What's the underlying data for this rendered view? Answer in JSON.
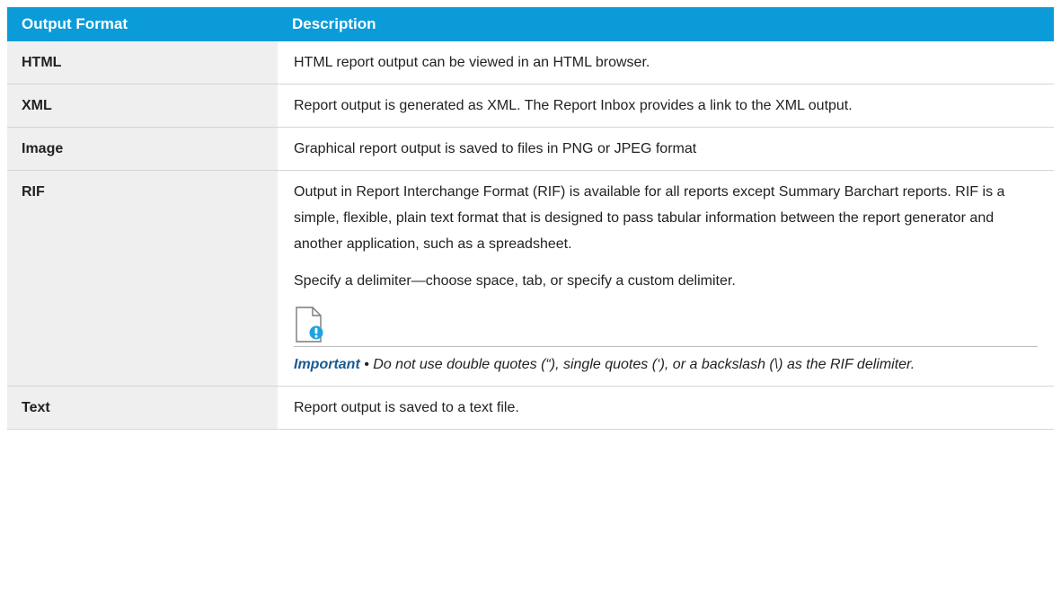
{
  "table": {
    "headers": {
      "format": "Output Format",
      "description": "Description"
    },
    "rows": [
      {
        "format": "HTML",
        "paragraphs": [
          "HTML report output can be viewed in an HTML browser."
        ]
      },
      {
        "format": "XML",
        "paragraphs": [
          "Report output is generated as XML. The Report Inbox provides a link to the XML output."
        ]
      },
      {
        "format": "Image",
        "paragraphs": [
          "Graphical report output is saved to files in PNG or JPEG format"
        ]
      },
      {
        "format": "RIF",
        "paragraphs": [
          "Output in Report Interchange Format (RIF) is available for all reports except Summary Barchart reports. RIF is a simple, flexible, plain text format that is designed to pass tabular information between the report generator and another application, such as a spreadsheet.",
          "Specify a delimiter—choose space, tab, or specify a custom delimiter."
        ],
        "note": {
          "icon": "important-note-icon",
          "label": "Important",
          "separator": " • ",
          "text": "Do not use double quotes (“), single quotes (‘), or a backslash (\\) as the RIF delimiter."
        }
      },
      {
        "format": "Text",
        "paragraphs": [
          "Report output is saved to a text file."
        ]
      }
    ]
  },
  "colors": {
    "header_bg": "#0b9bd8",
    "header_text": "#ffffff",
    "format_cell_bg": "#efefef",
    "note_label": "#1a5b93",
    "note_icon_badge": "#1fa3e0"
  }
}
